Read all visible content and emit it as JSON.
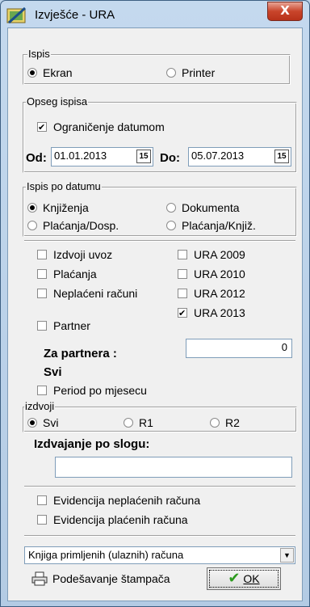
{
  "window": {
    "title": "Izvješće - URA",
    "close_label": "X"
  },
  "ispis": {
    "legend": "Ispis",
    "ekran": {
      "label": "Ekran",
      "selected": true
    },
    "printer": {
      "label": "Printer",
      "selected": false
    }
  },
  "opseg": {
    "legend": "Opseg ispisa",
    "ogranicenje": {
      "label": "Ograničenje datumom",
      "checked": true
    },
    "od_label": "Od:",
    "od_value": "01.01.2013",
    "do_label": "Do:",
    "do_value": "05.07.2013",
    "cal_label": "15"
  },
  "po_datumu": {
    "legend": "Ispis po datumu",
    "options": [
      {
        "label": "Knjiženja",
        "selected": true
      },
      {
        "label": "Dokumenta",
        "selected": false
      },
      {
        "label": "Plaćanja/Dosp.",
        "selected": false
      },
      {
        "label": "Plaćanja/Knjiž.",
        "selected": false
      }
    ]
  },
  "checks": {
    "left": [
      {
        "label": "Izdvoji uvoz",
        "checked": false
      },
      {
        "label": "Plaćanja",
        "checked": false
      },
      {
        "label": "Neplaćeni računi",
        "checked": false
      }
    ],
    "right": [
      {
        "label": "URA 2009",
        "checked": false
      },
      {
        "label": "URA 2010",
        "checked": false
      },
      {
        "label": "URA 2012",
        "checked": false
      },
      {
        "label": "URA 2013",
        "checked": true
      }
    ],
    "partner": {
      "label": "Partner",
      "checked": false
    }
  },
  "za_partnera": {
    "label": "Za partnera :",
    "value": "0",
    "svi": "Svi"
  },
  "period": {
    "label": "Period po mjesecu",
    "checked": false
  },
  "izdvoji": {
    "legend": "izdvoji",
    "options": [
      {
        "label": "Svi",
        "selected": true
      },
      {
        "label": "R1",
        "selected": false
      },
      {
        "label": "R2",
        "selected": false
      }
    ]
  },
  "slog": {
    "label": "Izdvajanje po slogu:",
    "value": ""
  },
  "evidencija": [
    {
      "label": "Evidencija neplaćenih računa",
      "checked": false
    },
    {
      "label": "Evidencija plaćenih računa",
      "checked": false
    }
  ],
  "report_select": {
    "value": "Knjiga primljenih (ulaznih) računa"
  },
  "buttons": {
    "print_settings": "Podešavanje štampača",
    "ok": "OK"
  }
}
